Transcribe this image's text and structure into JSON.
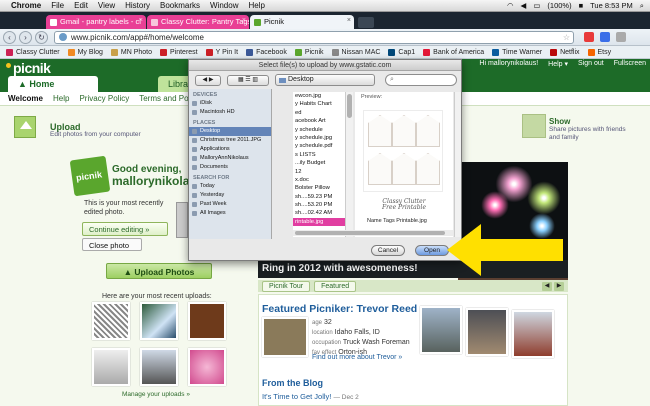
{
  "menubar": {
    "app": "Chrome",
    "items": [
      "File",
      "Edit",
      "View",
      "History",
      "Bookmarks",
      "Window",
      "Help"
    ],
    "battery": "(100%)",
    "clock": "Tue 8:53 PM"
  },
  "tabs": [
    {
      "label": "Gmail - pantry labels - cl",
      "color": "#e93f95"
    },
    {
      "label": "Classy Clutter: Pantry Tags",
      "color": "#e93f95"
    },
    {
      "label": "Picnik",
      "color": "#f0f4f8"
    }
  ],
  "address": "www.picnik.com/app#/home/welcome",
  "bookmarks": [
    {
      "label": "Classy Clutter",
      "color": "#cc2255"
    },
    {
      "label": "My Blog",
      "color": "#f08a24"
    },
    {
      "label": "MN Photo",
      "color": "#c8a04a"
    },
    {
      "label": "Pinterest",
      "color": "#cb2027"
    },
    {
      "label": "Y Pin It",
      "color": "#cb2027"
    },
    {
      "label": "Facebook",
      "color": "#3b5998"
    },
    {
      "label": "Picnik",
      "color": "#5aa62d"
    },
    {
      "label": "Nissan MAC",
      "color": "#888888"
    },
    {
      "label": "Cap1",
      "color": "#004879"
    },
    {
      "label": "Bank of America",
      "color": "#e31837"
    },
    {
      "label": "Time Warner",
      "color": "#0a5c9e"
    },
    {
      "label": "Netflix",
      "color": "#b9090b"
    },
    {
      "label": "Etsy",
      "color": "#f56400"
    }
  ],
  "picnik": {
    "logo": "picnik",
    "tabs": [
      "Home",
      "Library"
    ],
    "user_links": [
      "Hi mallorynikolaus!",
      "Help ▾",
      "Sign out",
      "Fullscreen"
    ],
    "subnav": [
      "Welcome",
      "Help",
      "Privacy Policy",
      "Terms and Polic"
    ],
    "upload_title": "Upload",
    "upload_sub": "Edit photos from your computer",
    "greeting1": "Good evening,",
    "greeting2": "mallorynikolau",
    "edited_text": "This is your most recently edited photo.",
    "continue_btn": "Continue editing »",
    "close_btn": "Close photo",
    "upload_photos_btn": "Upload Photos",
    "recent_label": "Here are your most recent uploads:",
    "manage_link": "Manage your uploads »",
    "show_title": "Show",
    "show_sub1": "Share pictures with friends",
    "show_sub2": "and family",
    "ring_text": "Ring in 2012 with awesomeness!",
    "w_btn": "w!",
    "ptabs": [
      "Picnik Tour",
      "Featured"
    ],
    "featured_title": "Featured Picniker: Trevor Reed",
    "featured_meta": [
      {
        "k": "age",
        "v": "32"
      },
      {
        "k": "location",
        "v": "Idaho Falls, ID"
      },
      {
        "k": "occupation",
        "v": "Truck Wash Foreman"
      },
      {
        "k": "fav effect",
        "v": "Orton-ish"
      }
    ],
    "featured_more": "Find out more about Trevor »",
    "blog_title": "From the Blog",
    "blog_post": "It's Time to Get Jolly!",
    "blog_date": "— Dec 2"
  },
  "dialog": {
    "title": "Select file(s) to upload by www.gstatic.com",
    "location": "Desktop",
    "search_placeholder": "",
    "devices_header": "DEVICES",
    "devices": [
      "iDisk",
      "Macintosh HD"
    ],
    "places_header": "PLACES",
    "places": [
      "Desktop",
      "Christmas tree 2011.JPG",
      "Applications",
      "MalloryAnnNikolaus",
      "Documents"
    ],
    "search_header": "SEARCH FOR",
    "searches": [
      "Today",
      "Yesterday",
      "Past Week",
      "All Images"
    ],
    "files": [
      "ewcon.jpg",
      "y Habits Chart",
      "ed",
      "acebook Art",
      "y schedule",
      "y schedule.jpg",
      "y schedule.pdf",
      "s LISTS",
      "...ily Budget",
      "12",
      "x.doc",
      "Bolster Pillow",
      "sh....59.23 PM",
      "sh....53.20 PM",
      "sh....02.42 AM",
      "rintable.jpg"
    ],
    "preview_label": "Preview:",
    "preview_script": "Classy Clutter Free Printable",
    "preview_name": "Name  Tags Printable.jpg",
    "cancel": "Cancel",
    "open": "Open"
  }
}
